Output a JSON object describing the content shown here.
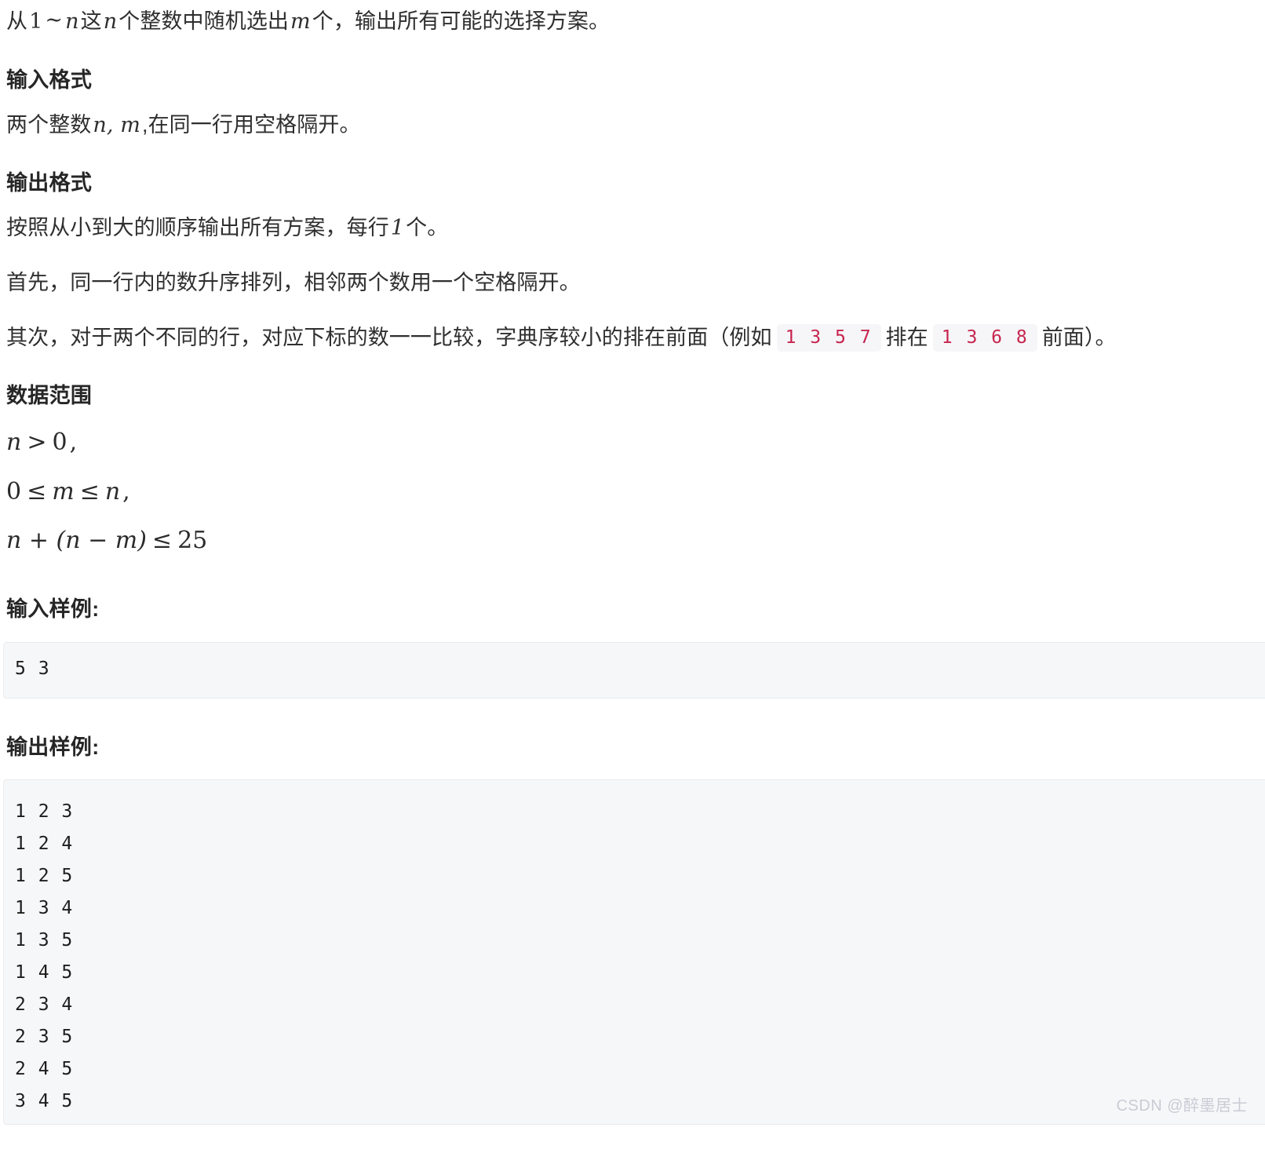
{
  "document": {
    "intro": {
      "prefix": "从",
      "math_range_start": "1",
      "math_tilde": "∼",
      "math_range_end": "n",
      "mid1": "这",
      "math_n": "n",
      "mid2": "个整数中随机选出",
      "math_m": "m",
      "suffix": "个，输出所有可能的选择方案。"
    },
    "sections": [
      {
        "id": "input-format",
        "heading": "输入格式",
        "body_prefix": "两个整数",
        "body_math": "n, m",
        "body_suffix": ",在同一行用空格隔开。"
      },
      {
        "id": "output-format",
        "heading": "输出格式",
        "paragraph_1_prefix": "按照从小到大的顺序输出所有方案，每行",
        "paragraph_1_math": "1",
        "paragraph_1_suffix": "个。",
        "paragraph_2": "首先，同一行内的数升序排列，相邻两个数用一个空格隔开。",
        "paragraph_3_prefix": "其次，对于两个不同的行，对应下标的数一一比较，字典序较小的排在前面（例如",
        "paragraph_3_code_1": "1 3 5 7",
        "paragraph_3_mid": "排在",
        "paragraph_3_code_2": "1 3 6 8",
        "paragraph_3_suffix": "前面）。"
      },
      {
        "id": "data-range",
        "heading": "数据范围",
        "constraints": [
          {
            "lhs": "n",
            "op": ">",
            "rhs": "0",
            "tail": ","
          },
          {
            "lhs": "0",
            "op": "≤",
            "mid": "m",
            "op2": "≤",
            "rhs": "n",
            "tail": ","
          },
          {
            "lhs": "n + (n − m)",
            "op": "≤",
            "rhs": "25",
            "tail": ""
          }
        ]
      }
    ],
    "input_sample": {
      "heading": "输入样例:",
      "lines": [
        "5 3"
      ]
    },
    "output_sample": {
      "heading": "输出样例:",
      "lines": [
        "1 2 3",
        "1 2 4",
        "1 2 5",
        "1 3 4",
        "1 3 5",
        "1 4 5",
        "2 3 4",
        "2 3 5",
        "2 4 5",
        "3 4 5"
      ]
    },
    "watermark": "CSDN @醉墨居士",
    "colors": {
      "text": "#2f2f2f",
      "heading": "#262626",
      "inline_code_text": "#c7254e",
      "inline_code_bg": "#f6f6f8",
      "code_block_bg": "#f6f7f9",
      "watermark": "#c8ccd4"
    }
  }
}
